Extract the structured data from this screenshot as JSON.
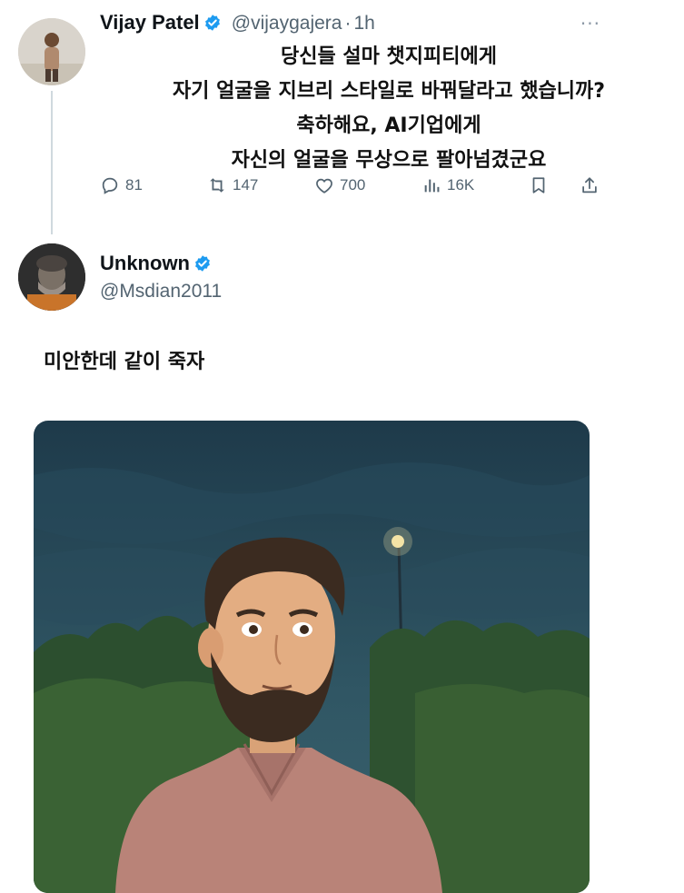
{
  "tweet": {
    "author_name": "Vijay Patel",
    "author_handle": "@vijaygajera",
    "time_sep": "·",
    "time": "1h",
    "more": "···",
    "lines": [
      "당신들 설마 챗지피티에게",
      "자기 얼굴을 지브리 스타일로 바꿔달라고 했습니까?",
      "축하해요, AI기업에게",
      "자신의 얼굴을 무상으로 팔아넘겼군요"
    ],
    "stats": {
      "replies": "81",
      "retweets": "147",
      "likes": "700",
      "views": "16K"
    }
  },
  "reply": {
    "author_name": "Unknown",
    "author_handle": "@Msdian2011",
    "text": "미안한데 같이 죽자"
  },
  "colors": {
    "verified": "#1d9bf0",
    "muted": "#536471",
    "thread_line": "#cfd9de"
  },
  "icons": [
    "reply-icon",
    "retweet-icon",
    "like-icon",
    "views-icon",
    "bookmark-icon",
    "share-icon",
    "verified-badge-icon"
  ]
}
